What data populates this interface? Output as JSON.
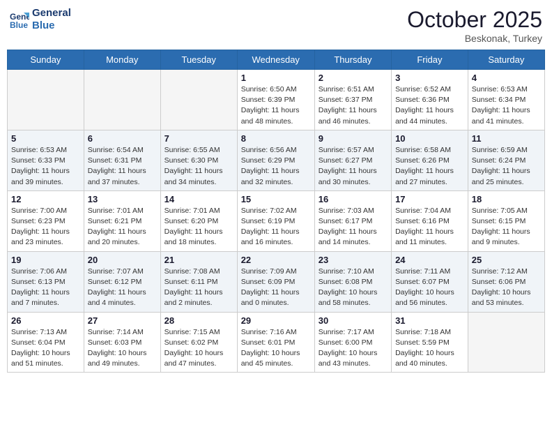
{
  "header": {
    "logo_line1": "General",
    "logo_line2": "Blue",
    "month": "October 2025",
    "location": "Beskonak, Turkey"
  },
  "weekdays": [
    "Sunday",
    "Monday",
    "Tuesday",
    "Wednesday",
    "Thursday",
    "Friday",
    "Saturday"
  ],
  "weeks": [
    [
      {
        "day": "",
        "info": ""
      },
      {
        "day": "",
        "info": ""
      },
      {
        "day": "",
        "info": ""
      },
      {
        "day": "1",
        "info": "Sunrise: 6:50 AM\nSunset: 6:39 PM\nDaylight: 11 hours\nand 48 minutes."
      },
      {
        "day": "2",
        "info": "Sunrise: 6:51 AM\nSunset: 6:37 PM\nDaylight: 11 hours\nand 46 minutes."
      },
      {
        "day": "3",
        "info": "Sunrise: 6:52 AM\nSunset: 6:36 PM\nDaylight: 11 hours\nand 44 minutes."
      },
      {
        "day": "4",
        "info": "Sunrise: 6:53 AM\nSunset: 6:34 PM\nDaylight: 11 hours\nand 41 minutes."
      }
    ],
    [
      {
        "day": "5",
        "info": "Sunrise: 6:53 AM\nSunset: 6:33 PM\nDaylight: 11 hours\nand 39 minutes."
      },
      {
        "day": "6",
        "info": "Sunrise: 6:54 AM\nSunset: 6:31 PM\nDaylight: 11 hours\nand 37 minutes."
      },
      {
        "day": "7",
        "info": "Sunrise: 6:55 AM\nSunset: 6:30 PM\nDaylight: 11 hours\nand 34 minutes."
      },
      {
        "day": "8",
        "info": "Sunrise: 6:56 AM\nSunset: 6:29 PM\nDaylight: 11 hours\nand 32 minutes."
      },
      {
        "day": "9",
        "info": "Sunrise: 6:57 AM\nSunset: 6:27 PM\nDaylight: 11 hours\nand 30 minutes."
      },
      {
        "day": "10",
        "info": "Sunrise: 6:58 AM\nSunset: 6:26 PM\nDaylight: 11 hours\nand 27 minutes."
      },
      {
        "day": "11",
        "info": "Sunrise: 6:59 AM\nSunset: 6:24 PM\nDaylight: 11 hours\nand 25 minutes."
      }
    ],
    [
      {
        "day": "12",
        "info": "Sunrise: 7:00 AM\nSunset: 6:23 PM\nDaylight: 11 hours\nand 23 minutes."
      },
      {
        "day": "13",
        "info": "Sunrise: 7:01 AM\nSunset: 6:21 PM\nDaylight: 11 hours\nand 20 minutes."
      },
      {
        "day": "14",
        "info": "Sunrise: 7:01 AM\nSunset: 6:20 PM\nDaylight: 11 hours\nand 18 minutes."
      },
      {
        "day": "15",
        "info": "Sunrise: 7:02 AM\nSunset: 6:19 PM\nDaylight: 11 hours\nand 16 minutes."
      },
      {
        "day": "16",
        "info": "Sunrise: 7:03 AM\nSunset: 6:17 PM\nDaylight: 11 hours\nand 14 minutes."
      },
      {
        "day": "17",
        "info": "Sunrise: 7:04 AM\nSunset: 6:16 PM\nDaylight: 11 hours\nand 11 minutes."
      },
      {
        "day": "18",
        "info": "Sunrise: 7:05 AM\nSunset: 6:15 PM\nDaylight: 11 hours\nand 9 minutes."
      }
    ],
    [
      {
        "day": "19",
        "info": "Sunrise: 7:06 AM\nSunset: 6:13 PM\nDaylight: 11 hours\nand 7 minutes."
      },
      {
        "day": "20",
        "info": "Sunrise: 7:07 AM\nSunset: 6:12 PM\nDaylight: 11 hours\nand 4 minutes."
      },
      {
        "day": "21",
        "info": "Sunrise: 7:08 AM\nSunset: 6:11 PM\nDaylight: 11 hours\nand 2 minutes."
      },
      {
        "day": "22",
        "info": "Sunrise: 7:09 AM\nSunset: 6:09 PM\nDaylight: 11 hours\nand 0 minutes."
      },
      {
        "day": "23",
        "info": "Sunrise: 7:10 AM\nSunset: 6:08 PM\nDaylight: 10 hours\nand 58 minutes."
      },
      {
        "day": "24",
        "info": "Sunrise: 7:11 AM\nSunset: 6:07 PM\nDaylight: 10 hours\nand 56 minutes."
      },
      {
        "day": "25",
        "info": "Sunrise: 7:12 AM\nSunset: 6:06 PM\nDaylight: 10 hours\nand 53 minutes."
      }
    ],
    [
      {
        "day": "26",
        "info": "Sunrise: 7:13 AM\nSunset: 6:04 PM\nDaylight: 10 hours\nand 51 minutes."
      },
      {
        "day": "27",
        "info": "Sunrise: 7:14 AM\nSunset: 6:03 PM\nDaylight: 10 hours\nand 49 minutes."
      },
      {
        "day": "28",
        "info": "Sunrise: 7:15 AM\nSunset: 6:02 PM\nDaylight: 10 hours\nand 47 minutes."
      },
      {
        "day": "29",
        "info": "Sunrise: 7:16 AM\nSunset: 6:01 PM\nDaylight: 10 hours\nand 45 minutes."
      },
      {
        "day": "30",
        "info": "Sunrise: 7:17 AM\nSunset: 6:00 PM\nDaylight: 10 hours\nand 43 minutes."
      },
      {
        "day": "31",
        "info": "Sunrise: 7:18 AM\nSunset: 5:59 PM\nDaylight: 10 hours\nand 40 minutes."
      },
      {
        "day": "",
        "info": ""
      }
    ]
  ]
}
